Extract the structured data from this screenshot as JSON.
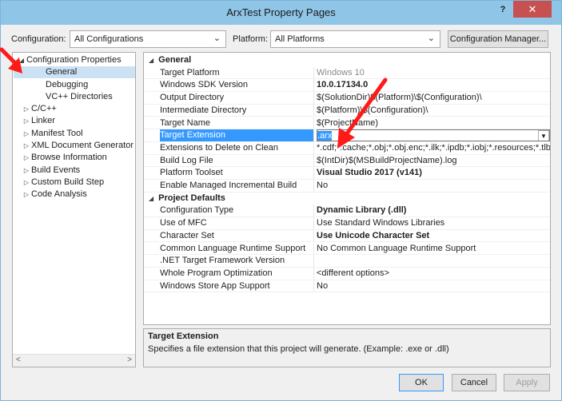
{
  "window": {
    "title": "ArxTest Property Pages",
    "help_label": "?",
    "close_label": "✕"
  },
  "toolbar": {
    "configuration_label": "Configuration:",
    "configuration_value": "All Configurations",
    "platform_label": "Platform:",
    "platform_value": "All Platforms",
    "config_manager_label": "Configuration Manager..."
  },
  "tree": {
    "items": [
      {
        "label": "Configuration Properties",
        "expander": "◢"
      },
      {
        "label": "General"
      },
      {
        "label": "Debugging"
      },
      {
        "label": "VC++ Directories"
      },
      {
        "label": "C/C++",
        "expander": "▷"
      },
      {
        "label": "Linker",
        "expander": "▷"
      },
      {
        "label": "Manifest Tool",
        "expander": "▷"
      },
      {
        "label": "XML Document Generator",
        "expander": "▷"
      },
      {
        "label": "Browse Information",
        "expander": "▷"
      },
      {
        "label": "Build Events",
        "expander": "▷"
      },
      {
        "label": "Custom Build Step",
        "expander": "▷"
      },
      {
        "label": "Code Analysis",
        "expander": "▷"
      }
    ],
    "scroll_left": "<",
    "scroll_right": ">"
  },
  "grid": {
    "rows": [
      {
        "name": "General",
        "category": true,
        "expander": "◢"
      },
      {
        "name": "Target Platform",
        "value": "Windows 10",
        "grey": true
      },
      {
        "name": "Windows SDK Version",
        "value": "10.0.17134.0",
        "bold": true
      },
      {
        "name": "Output Directory",
        "value": "$(SolutionDir)$(Platform)\\$(Configuration)\\"
      },
      {
        "name": "Intermediate Directory",
        "value": "$(Platform)\\$(Configuration)\\"
      },
      {
        "name": "Target Name",
        "value": "$(ProjectName)"
      },
      {
        "name": "Target Extension",
        "value": ".arx",
        "selected": true
      },
      {
        "name": "Extensions to Delete on Clean",
        "value": "*.cdf;*.cache;*.obj;*.obj.enc;*.ilk;*.ipdb;*.iobj;*.resources;*.tlb;*.tli;*.t"
      },
      {
        "name": "Build Log File",
        "value": "$(IntDir)$(MSBuildProjectName).log"
      },
      {
        "name": "Platform Toolset",
        "value": "Visual Studio 2017 (v141)",
        "bold": true
      },
      {
        "name": "Enable Managed Incremental Build",
        "value": "No"
      },
      {
        "name": "Project Defaults",
        "category": true,
        "expander": "◢"
      },
      {
        "name": "Configuration Type",
        "value": "Dynamic Library (.dll)",
        "bold": true
      },
      {
        "name": "Use of MFC",
        "value": "Use Standard Windows Libraries"
      },
      {
        "name": "Character Set",
        "value": "Use Unicode Character Set",
        "bold": true
      },
      {
        "name": "Common Language Runtime Support",
        "value": "No Common Language Runtime Support"
      },
      {
        "name": ".NET Target Framework Version",
        "value": ""
      },
      {
        "name": "Whole Program Optimization",
        "value": "<different options>"
      },
      {
        "name": "Windows Store App Support",
        "value": "No"
      }
    ]
  },
  "description": {
    "title": "Target Extension",
    "text": "Specifies a file extension that this project will generate. (Example: .exe or .dll)"
  },
  "buttons": {
    "ok": "OK",
    "cancel": "Cancel",
    "apply": "Apply"
  },
  "colors": {
    "selection": "#3399ff",
    "annotation_arrow": "#ff1a1a",
    "titlebar": "#8fc5e6",
    "close": "#c75050"
  },
  "icons": {
    "dropdown": "chevron-down-icon",
    "expand": "triangle-expand-icon"
  }
}
